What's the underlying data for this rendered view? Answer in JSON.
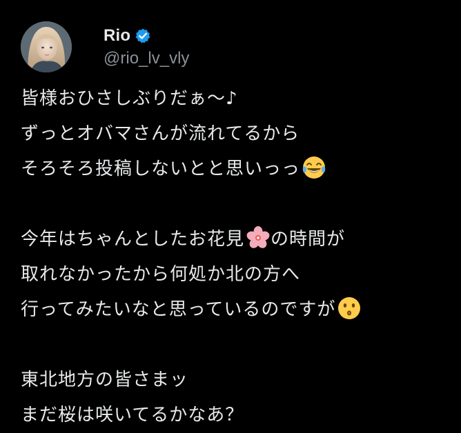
{
  "theme": {
    "background": "#000000",
    "text_color": "#e7e9ea",
    "handle_color": "#8b9298",
    "verified_color": "#1d9bf0"
  },
  "author": {
    "display_name": "Rio",
    "handle": "@rio_lv_vly",
    "verified": true,
    "avatar_icon": "profile-photo"
  },
  "post": {
    "lines": [
      {
        "text": "皆様おひさしぶりだぁ～♪",
        "emoji": ""
      },
      {
        "text": "ずっとオバマさんが流れてるから",
        "emoji": ""
      },
      {
        "text": "そろそろ投稿しないとと思いっっ",
        "emoji": "face-with-tears-of-joy"
      },
      {
        "text": "",
        "emoji": ""
      },
      {
        "text_before": "今年はちゃんとしたお花見",
        "emoji": "cherry-blossom",
        "text_after": "の時間が"
      },
      {
        "text": "取れなかったから何処か北の方へ",
        "emoji": ""
      },
      {
        "text": "行ってみたいなと思っているのですが",
        "emoji": "kissing-face"
      },
      {
        "text": "",
        "emoji": ""
      },
      {
        "text": "東北地方の皆さまッ",
        "emoji": ""
      },
      {
        "text": "まだ桜は咲いてるかなあ？",
        "emoji": ""
      }
    ]
  }
}
